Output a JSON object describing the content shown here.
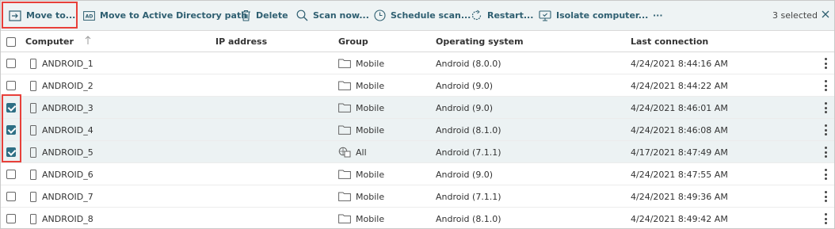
{
  "toolbar": {
    "move_to": "Move to...",
    "move_ad": "Move to Active Directory path",
    "delete": "Delete",
    "scan_now": "Scan now...",
    "schedule_scan": "Schedule scan...",
    "restart": "Restart...",
    "isolate": "Isolate computer...",
    "more": "···",
    "selected_count": "3 selected",
    "ad_badge": "AD"
  },
  "columns": {
    "computer": "Computer",
    "ip": "IP address",
    "group": "Group",
    "os": "Operating system",
    "last_connection": "Last connection"
  },
  "rows": [
    {
      "computer": "ANDROID_1",
      "ip": "",
      "group": "Mobile",
      "group_icon": "folder-icon",
      "os": "Android (8.0.0)",
      "last": "4/24/2021 8:44:16 AM",
      "selected": false
    },
    {
      "computer": "ANDROID_2",
      "ip": "",
      "group": "Mobile",
      "group_icon": "folder-icon",
      "os": "Android (9.0)",
      "last": "4/24/2021 8:44:22 AM",
      "selected": false
    },
    {
      "computer": "ANDROID_3",
      "ip": "",
      "group": "Mobile",
      "group_icon": "folder-icon",
      "os": "Android (9.0)",
      "last": "4/24/2021 8:46:01 AM",
      "selected": true
    },
    {
      "computer": "ANDROID_4",
      "ip": "",
      "group": "Mobile",
      "group_icon": "folder-icon",
      "os": "Android (8.1.0)",
      "last": "4/24/2021 8:46:08 AM",
      "selected": true
    },
    {
      "computer": "ANDROID_5",
      "ip": "",
      "group": "All",
      "group_icon": "all-groups-icon",
      "os": "Android (7.1.1)",
      "last": "4/17/2021 8:47:49 AM",
      "selected": true
    },
    {
      "computer": "ANDROID_6",
      "ip": "",
      "group": "Mobile",
      "group_icon": "folder-icon",
      "os": "Android (9.0)",
      "last": "4/24/2021 8:47:55 AM",
      "selected": false
    },
    {
      "computer": "ANDROID_7",
      "ip": "",
      "group": "Mobile",
      "group_icon": "folder-icon",
      "os": "Android (7.1.1)",
      "last": "4/24/2021 8:49:36 AM",
      "selected": false
    },
    {
      "computer": "ANDROID_8",
      "ip": "",
      "group": "Mobile",
      "group_icon": "folder-icon",
      "os": "Android (8.1.0)",
      "last": "4/24/2021 8:49:42 AM",
      "selected": false
    }
  ],
  "colors": {
    "accent": "#2f5f71",
    "checkbox_checked": "#2e6f85",
    "selected_row": "#ecf2f3",
    "toolbar_bg": "#eef3f4",
    "highlight": "#e8403a"
  }
}
